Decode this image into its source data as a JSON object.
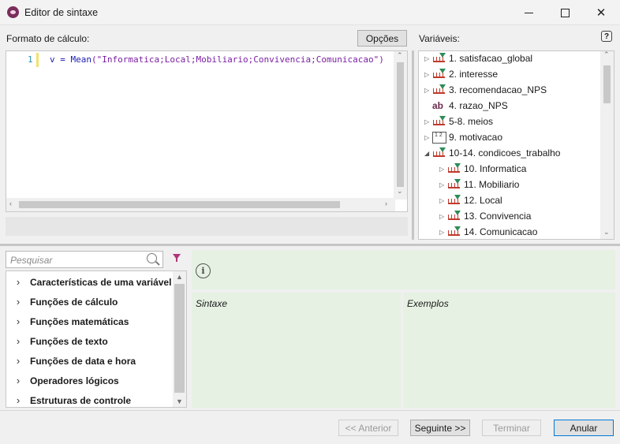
{
  "window": {
    "title": "Editor de sintaxe",
    "accent": "#7b2d5b"
  },
  "editor": {
    "label": "Formato de cálculo:",
    "options_button": "Opções",
    "line_number": "1",
    "code_prefix": "v = ",
    "code_func": "Mean",
    "code_args": "(\"Informatica;Local;Mobiliario;Convivencia;Comunicacao\")"
  },
  "variables": {
    "label": "Variáveis:",
    "help": "?",
    "items": [
      {
        "label": "1. satisfacao_global",
        "icon": "scale-icon",
        "expander": "▷",
        "indent": 0
      },
      {
        "label": "2. interesse",
        "icon": "scale-icon",
        "expander": "▷",
        "indent": 0
      },
      {
        "label": "3. recomendacao_NPS",
        "icon": "scale-icon",
        "expander": "▷",
        "indent": 0
      },
      {
        "label": "4. razao_NPS",
        "icon": "text-icon",
        "expander": "",
        "indent": 0
      },
      {
        "label": "5-8. meios",
        "icon": "scale-group-icon",
        "expander": "▷",
        "indent": 0
      },
      {
        "label": "9. motivacao",
        "icon": "grid-icon",
        "expander": "▷",
        "indent": 0
      },
      {
        "label": "10-14. condicoes_trabalho",
        "icon": "scale-group-icon",
        "expander": "◢",
        "indent": 0
      },
      {
        "label": "10. Informatica",
        "icon": "scale-icon",
        "expander": "▷",
        "indent": 1
      },
      {
        "label": "11. Mobiliario",
        "icon": "scale-icon",
        "expander": "▷",
        "indent": 1
      },
      {
        "label": "12. Local",
        "icon": "scale-icon",
        "expander": "▷",
        "indent": 1
      },
      {
        "label": "13. Convivencia",
        "icon": "scale-icon",
        "expander": "▷",
        "indent": 1
      },
      {
        "label": "14. Comunicacao",
        "icon": "scale-icon",
        "expander": "▷",
        "indent": 1
      }
    ]
  },
  "functions": {
    "search_placeholder": "Pesquisar",
    "categories": [
      "Características de uma variável",
      "Funções de cálculo",
      "Funções matemáticas",
      "Funções de texto",
      "Funções de data e hora",
      "Operadores lógicos",
      "Estruturas de controle"
    ]
  },
  "help_panel": {
    "info": "i",
    "syntax_label": "Sintaxe",
    "examples_label": "Exemplos",
    "color": "#e6f1e3"
  },
  "footer": {
    "previous": "<< Anterior",
    "next": "Seguinte >>",
    "finish": "Terminar",
    "cancel": "Anular"
  }
}
